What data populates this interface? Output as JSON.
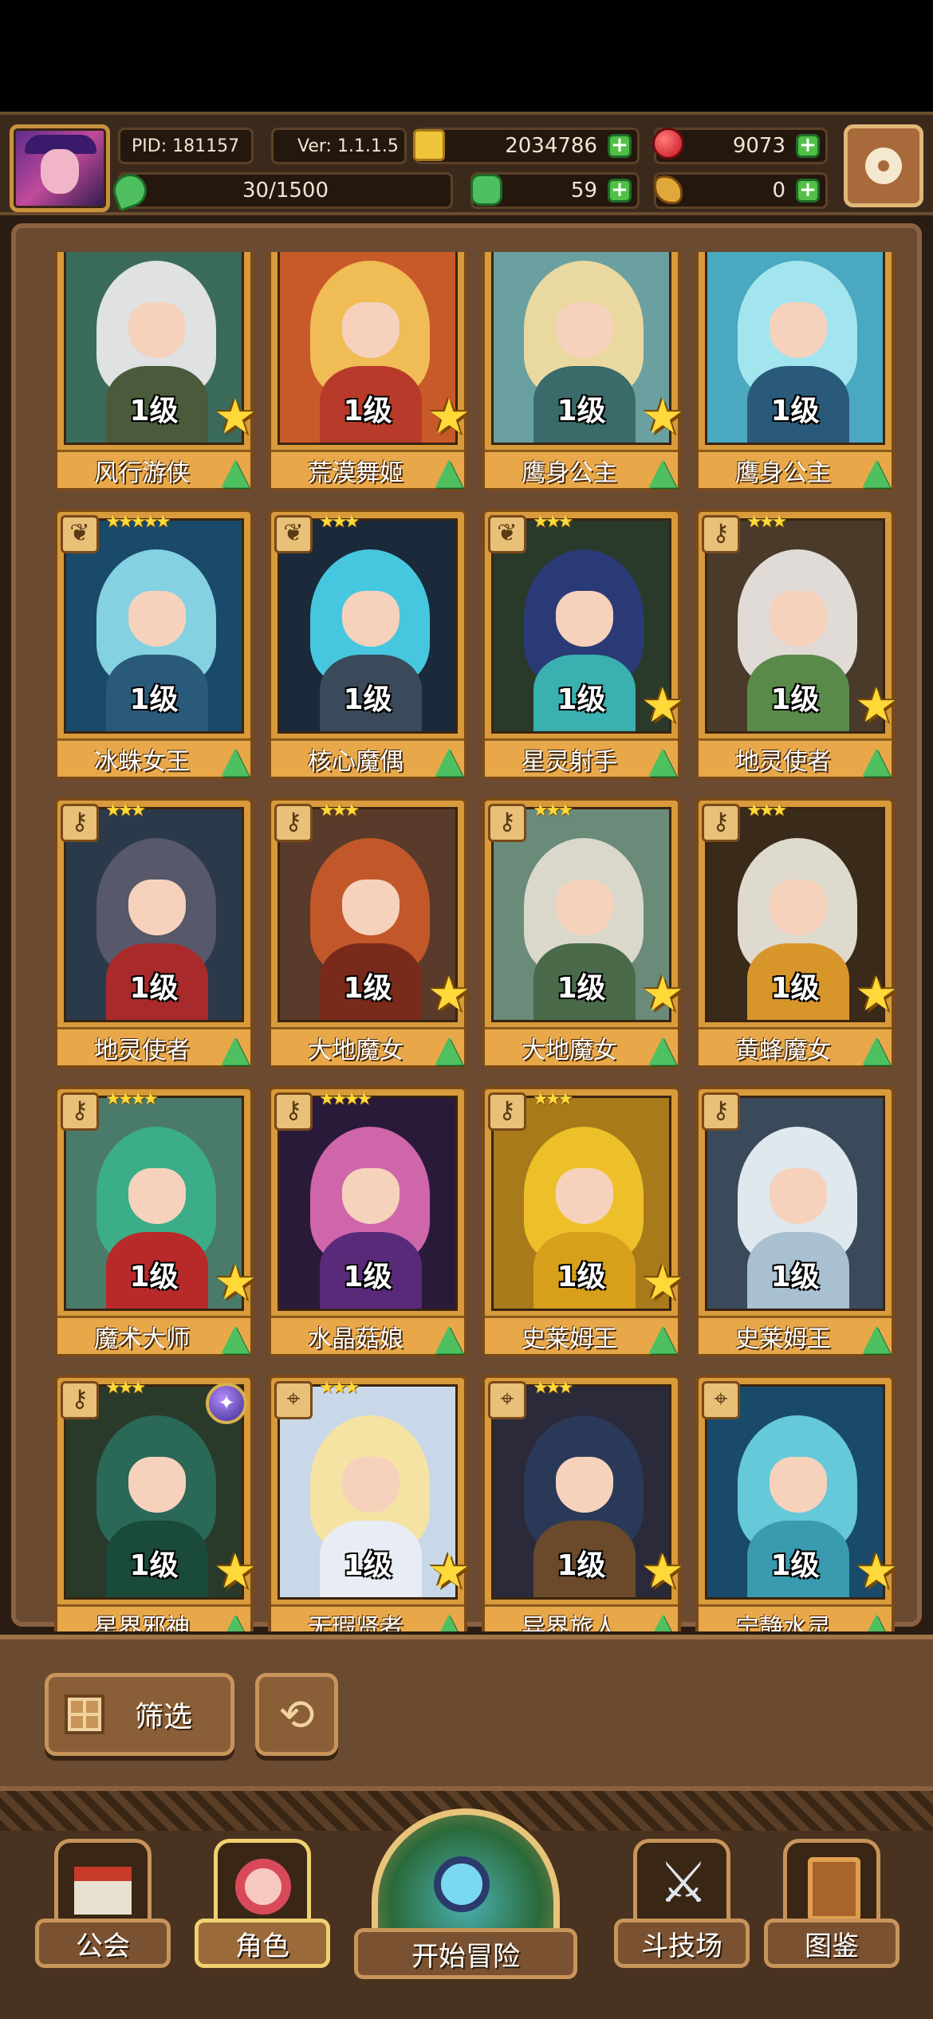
{
  "player": {
    "pid": "PID: 181157",
    "version": "Ver: 1.1.1.5",
    "gold": "2034786",
    "gems": "9073",
    "exp": "30/1500",
    "clover": "59",
    "keys": "0"
  },
  "icons": {
    "gold": "coin-icon",
    "gems": "red-gem-icon",
    "exp": "leaf-icon",
    "clover": "clover-icon",
    "keys": "key-icon",
    "settings": "gear-icon",
    "level_up": "green-tree-icon",
    "rank": "gold-star-icon"
  },
  "cards": [
    {
      "level": "1级",
      "name": "风行游侠",
      "star": true,
      "palette": [
        "#3a6a5a",
        "#e8e8ea",
        "#4a5a3a"
      ]
    },
    {
      "level": "1级",
      "name": "荒漠舞姬",
      "star": true,
      "palette": [
        "#c85a2a",
        "#f2c258",
        "#b83a2a"
      ]
    },
    {
      "level": "1级",
      "name": "鹰身公主",
      "star": true,
      "palette": [
        "#6aa0a0",
        "#f0dca0",
        "#3a6a6a"
      ]
    },
    {
      "level": "1级",
      "name": "鹰身公主",
      "star": false,
      "palette": [
        "#4aa8c0",
        "#a8e8f0",
        "#2a5a7a"
      ]
    },
    {
      "level": "1级",
      "name": "冰蛛女王",
      "star": false,
      "cls": "leaf",
      "stars": "★★★★★",
      "palette": [
        "#1a4a6a",
        "#8ad8e8",
        "#2a5a7a"
      ]
    },
    {
      "level": "1级",
      "name": "核心魔偶",
      "star": false,
      "cls": "leaf",
      "stars": "★★★",
      "palette": [
        "#1a2a3a",
        "#4ad0e8",
        "#3a4a5a"
      ]
    },
    {
      "level": "1级",
      "name": "星灵射手",
      "star": true,
      "cls": "leaf",
      "stars": "★★★",
      "palette": [
        "#2a3a2a",
        "#2a3a7a",
        "#3ab0b0"
      ]
    },
    {
      "level": "1级",
      "name": "地灵使者",
      "star": true,
      "cls": "key",
      "stars": "★★★",
      "palette": [
        "#4a3a2a",
        "#e8e4e0",
        "#5a8a4a"
      ]
    },
    {
      "level": "1级",
      "name": "地灵使者",
      "star": false,
      "cls": "key",
      "stars": "★★★",
      "palette": [
        "#2a3a4a",
        "#5a5a6a",
        "#a82a2a"
      ]
    },
    {
      "level": "1级",
      "name": "大地魔女",
      "star": true,
      "cls": "key",
      "stars": "★★★",
      "palette": [
        "#5a3a2a",
        "#c85a2a",
        "#7a2a1a"
      ]
    },
    {
      "level": "1级",
      "name": "大地魔女",
      "star": true,
      "cls": "key",
      "stars": "★★★",
      "palette": [
        "#6a8a7a",
        "#e0dcd0",
        "#4a6a4a"
      ]
    },
    {
      "level": "1级",
      "name": "黄蜂魔女",
      "star": true,
      "cls": "key",
      "stars": "★★★",
      "palette": [
        "#3a2a1a",
        "#e8e4d8",
        "#d8962a"
      ]
    },
    {
      "level": "1级",
      "name": "魔术大师",
      "star": true,
      "cls": "key",
      "stars": "★★★★",
      "palette": [
        "#4a7a6a",
        "#3ab08a",
        "#b82a2a"
      ]
    },
    {
      "level": "1级",
      "name": "水晶菇娘",
      "star": false,
      "cls": "key",
      "stars": "★★★★",
      "palette": [
        "#2a1a3a",
        "#d86ab0",
        "#5a2a7a"
      ]
    },
    {
      "level": "1级",
      "name": "史莱姆王",
      "star": true,
      "cls": "key",
      "stars": "★★★",
      "palette": [
        "#a87a1a",
        "#f0c42a",
        "#d8a01a"
      ]
    },
    {
      "level": "1级",
      "name": "史莱姆王",
      "star": false,
      "cls": "key",
      "stars": "",
      "palette": [
        "#3a4a5a",
        "#e8f0f4",
        "#a8c0d0"
      ]
    },
    {
      "level": "1级",
      "name": "星界邪神",
      "star": true,
      "cls": "key",
      "stars": "★★★",
      "orb": true,
      "palette": [
        "#2a3a2a",
        "#2a6a5a",
        "#1a4a3a"
      ]
    },
    {
      "level": "1级",
      "name": "无瑕贤者",
      "star": true,
      "cls": "target",
      "stars": "★★★",
      "palette": [
        "#c8d8e8",
        "#f8e4a0",
        "#e8ecf4"
      ]
    },
    {
      "level": "1级",
      "name": "异界旅人",
      "star": true,
      "cls": "target",
      "stars": "★★★",
      "palette": [
        "#2a2a3a",
        "#2a3a5a",
        "#6a4a2a"
      ]
    },
    {
      "level": "1级",
      "name": "宁静水灵",
      "star": true,
      "cls": "target",
      "stars": "",
      "palette": [
        "#1a4a6a",
        "#6ad0e0",
        "#3a9ab0"
      ]
    }
  ],
  "controls": {
    "filter_label": "筛选",
    "sort_icon": "refresh-icon"
  },
  "nav": {
    "guild": "公会",
    "character": "角色",
    "adventure": "开始冒险",
    "arena": "斗技场",
    "codex": "图鉴",
    "active": "character"
  }
}
